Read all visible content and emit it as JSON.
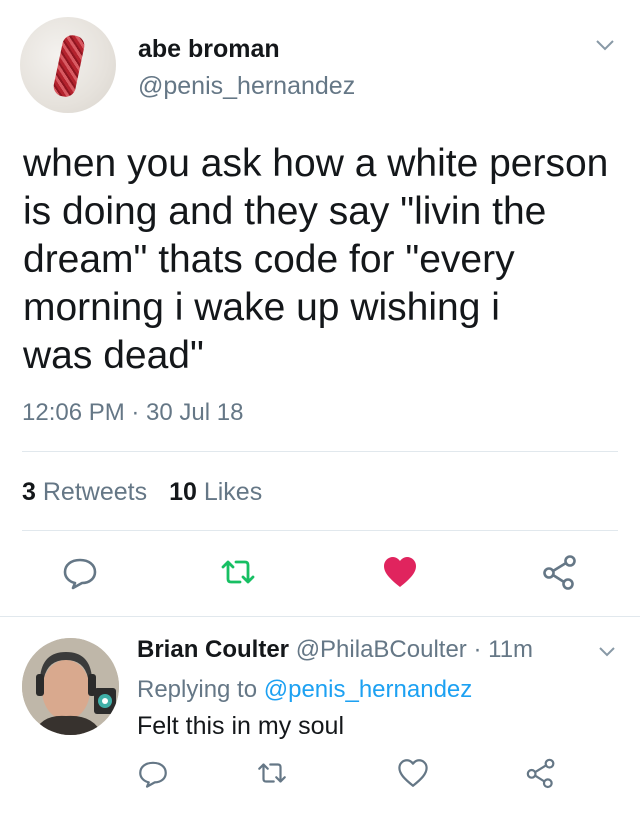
{
  "tweet": {
    "display_name": "abe broman",
    "handle": "@penis_hernandez",
    "text": "when you ask how a white person\nis doing and they say \"livin the\ndream\" thats code for \"every\nmorning i wake up wishing i\nwas dead\"",
    "timestamp": "12:06 PM · 30 Jul 18",
    "retweets_count": "3",
    "retweets_label": "Retweets",
    "likes_count": "10",
    "likes_label": "Likes",
    "liked": true
  },
  "reply": {
    "display_name": "Brian Coulter",
    "handle": "@PhilaBCoulter",
    "time": "· 11m",
    "replying_prefix": "Replying to",
    "replying_to": "@penis_hernandez",
    "text": "Felt this in my soul"
  },
  "icons": {
    "reply": "speech-bubble-icon",
    "retweet": "retweet-icon",
    "like": "heart-icon",
    "share": "share-icon",
    "menu": "chevron-down-icon"
  },
  "colors": {
    "text": "#14171a",
    "secondary": "#657786",
    "link": "#1da1f2",
    "retweet_green": "#17bf63",
    "like_red": "#e0245e",
    "divider": "#e1e8ed"
  }
}
